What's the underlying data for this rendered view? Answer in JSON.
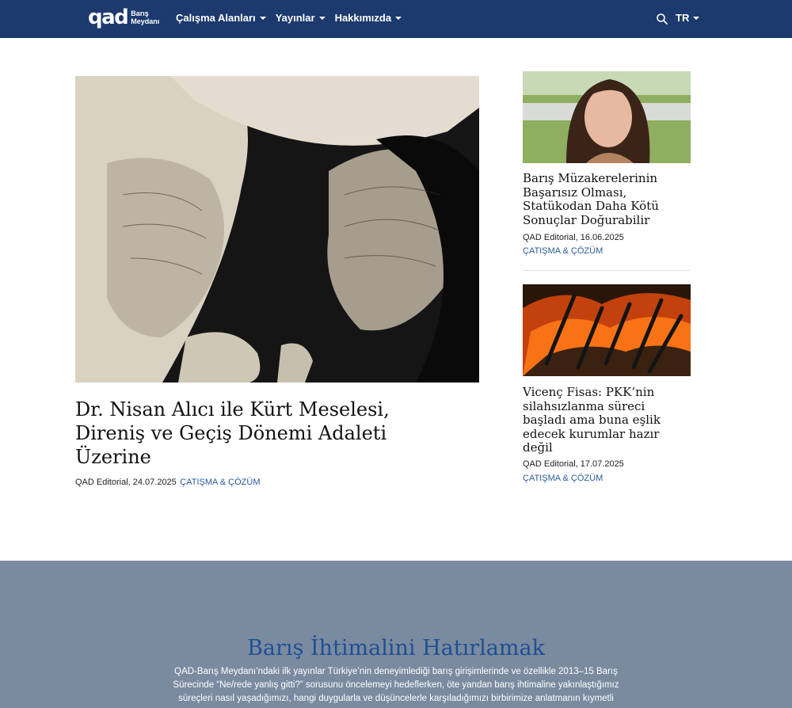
{
  "header": {
    "logo_mark": "qad",
    "logo_sub_line1": "Barış",
    "logo_sub_line2": "Meydanı",
    "nav": [
      {
        "label": "Çalışma Alanları"
      },
      {
        "label": "Yayınlar"
      },
      {
        "label": "Hakkımızda"
      }
    ],
    "lang": "TR",
    "colors": {
      "bar": "#1c3a6e"
    }
  },
  "featured": {
    "title": "Dr. Nisan Alıcı ile Kürt Meselesi, Direniş ve Geçiş Dönemi Adaleti Üzerine",
    "author_date": "QAD Editorial, 24.07.2025",
    "category": "ÇATIŞMA & ÇÖZÜM"
  },
  "side": [
    {
      "title": "Barış Müzakerelerinin Başarısız Olması, Statükodan Daha Kötü Sonuçlar Doğurabilir",
      "author_date": "QAD Editorial, 16.06.2025",
      "category": "ÇATIŞMA & ÇÖZÜM"
    },
    {
      "title": "Vicenç Fisas: PKK’nin silahsızlanma süreci başladı ama buna eşlik edecek kurumlar hazır değil",
      "author_date": "QAD Editorial, 17.07.2025",
      "category": "ÇATIŞMA & ÇÖZÜM"
    }
  ],
  "band": {
    "title": "Barış İhtimalini Hatırlamak",
    "text": "QAD-Barış Meydanı’ndaki ilk yayınlar Türkiye’nin deneyimlediği barış girişimlerinde ve özellikle 2013–15 Barış Sürecinde “Ne/rede yanlış gitti?” sorusunu öncelemeyi hedeflerken, öte yandan barış ihtimaline yakınlaştığımız süreçleri nasıl yaşadığımızı, hangi duygularla ve düşüncelerle karşıladığımızı birbirimize anlatmanın kıymetli"
  }
}
